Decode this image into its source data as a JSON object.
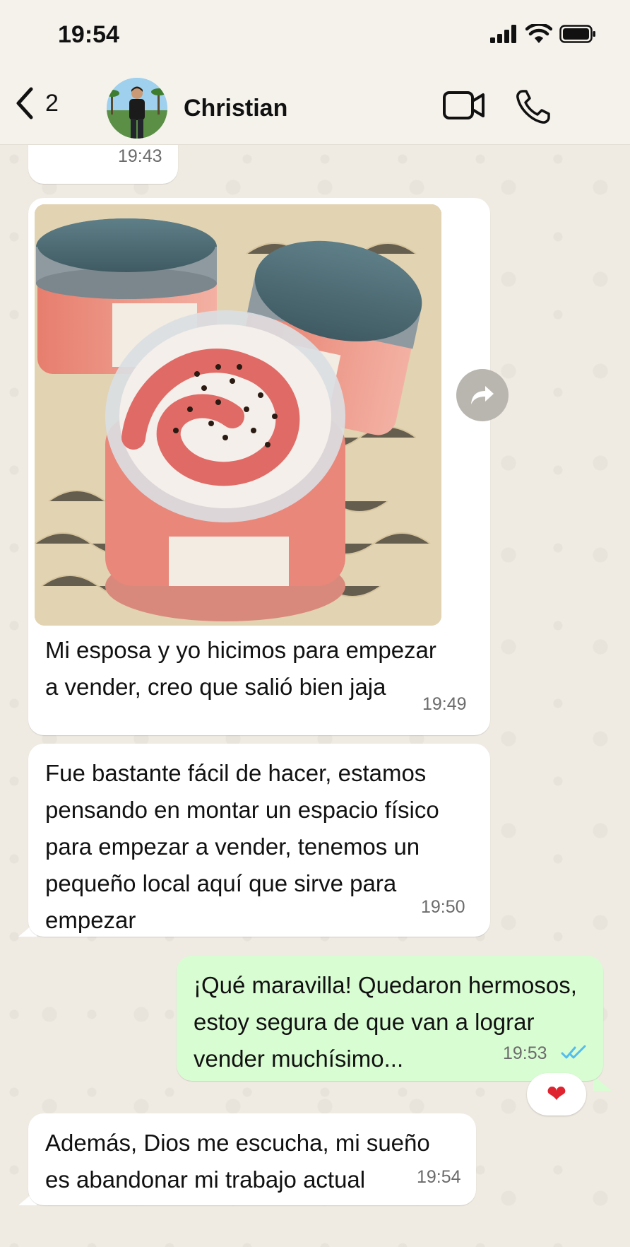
{
  "status": {
    "time": "19:54"
  },
  "header": {
    "back_count": "2",
    "contact_name": "Christian"
  },
  "messages": [
    {
      "time": "19:43"
    },
    {
      "text": "Mi esposa y yo hicimos para empezar\na vender, creo que salió bien jaja",
      "time": "19:49"
    },
    {
      "text": "Fue bastante fácil de hacer, estamos\npensando en montar un espacio físico\npara empezar a vender, tenemos un\npequeño local aquí que sirve para\nempezar",
      "time": "19:50"
    },
    {
      "text": "¡Qué maravilla! Quedaron hermosos,\nestoy segura de que van a lograr\nvender muchísimo...",
      "time": "19:53",
      "reaction": "❤"
    },
    {
      "text": "Además, Dios me escucha, mi sueño\nes abandonar mi trabajo actual",
      "time": "19:54"
    }
  ],
  "colors": {
    "chat_bg": "#efeae2",
    "incoming_bubble": "#ffffff",
    "outgoing_bubble": "#d9fdd3",
    "read_ticks": "#53bdeb"
  },
  "icons": {
    "back": "chevron-left-icon",
    "video": "video-camera-icon",
    "call": "phone-icon",
    "forward": "forward-arrow-icon",
    "read": "double-check-icon"
  }
}
